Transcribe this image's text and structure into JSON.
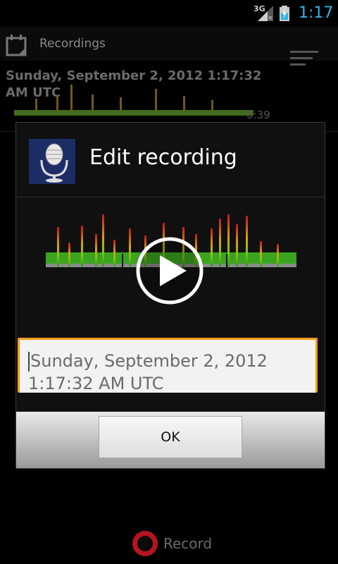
{
  "status_bar": {
    "network": "3G",
    "time": "1:17"
  },
  "action_bar": {
    "title": "Recordings"
  },
  "list_item": {
    "title": "Sunday, September 2, 2012 1:17:32 AM UTC",
    "duration": "0:39"
  },
  "dialog": {
    "title": "Edit recording",
    "field_value": "Sunday, September 2, 2012 1:17:32 AM UTC",
    "ok_label": "OK"
  },
  "bottom": {
    "record_label": "Record"
  },
  "colors": {
    "accent": "#33b5e5",
    "field_border": "#f39c12",
    "record": "#b7141f"
  }
}
